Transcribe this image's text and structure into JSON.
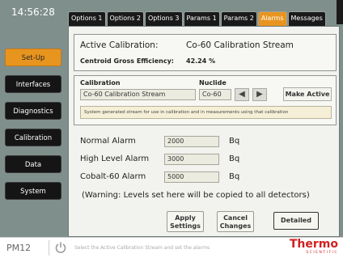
{
  "header": {
    "clock": "14:56:28",
    "tabs": [
      {
        "label": "Options 1",
        "active": false
      },
      {
        "label": "Options 2",
        "active": false
      },
      {
        "label": "Options 3",
        "active": false
      },
      {
        "label": "Params 1",
        "active": false
      },
      {
        "label": "Params 2",
        "active": false
      },
      {
        "label": "Alarms",
        "active": true
      },
      {
        "label": "Messages",
        "active": false
      }
    ]
  },
  "sidebar": {
    "items": [
      {
        "label": "Set-Up",
        "active": true
      },
      {
        "label": "Interfaces",
        "active": false
      },
      {
        "label": "Diagnostics",
        "active": false
      },
      {
        "label": "Calibration",
        "active": false
      },
      {
        "label": "Data",
        "active": false
      },
      {
        "label": "System",
        "active": false
      }
    ]
  },
  "calibration_info": {
    "active_label": "Active Calibration:",
    "active_value": "Co-60 Calibration Stream",
    "efficiency_label": "Centroid Gross Efficiency:",
    "efficiency_value": "42.24 %"
  },
  "selector": {
    "calibration_label": "Calibration",
    "calibration_value": "Co-60 Calibration Stream",
    "nuclide_label": "Nuclide",
    "nuclide_value": "Co-60",
    "make_active_label": "Make Active",
    "description": "System generated stream for use in calibration and in measurements using that calibration"
  },
  "alarms": {
    "normal": {
      "label": "Normal Alarm",
      "value": "2000",
      "unit": "Bq"
    },
    "high": {
      "label": "High Level Alarm",
      "value": "3000",
      "unit": "Bq"
    },
    "cobalt": {
      "label": "Cobalt-60 Alarm",
      "value": "5000",
      "unit": "Bq"
    },
    "warning": "(Warning:  Levels set here will be copied to all detectors)"
  },
  "buttons": {
    "apply_line1": "Apply",
    "apply_line2": "Settings",
    "cancel_line1": "Cancel",
    "cancel_line2": "Changes",
    "detailed": "Detailed"
  },
  "status_bar": {
    "device": "PM12",
    "message": "Select the Active Calibration Stream and set the alarms",
    "logo_main": "Thermo",
    "logo_sub": "SCIENTIFIC"
  },
  "colors": {
    "accent": "#e8951f",
    "background": "#7f8f8c",
    "logo": "#d11f1f"
  }
}
